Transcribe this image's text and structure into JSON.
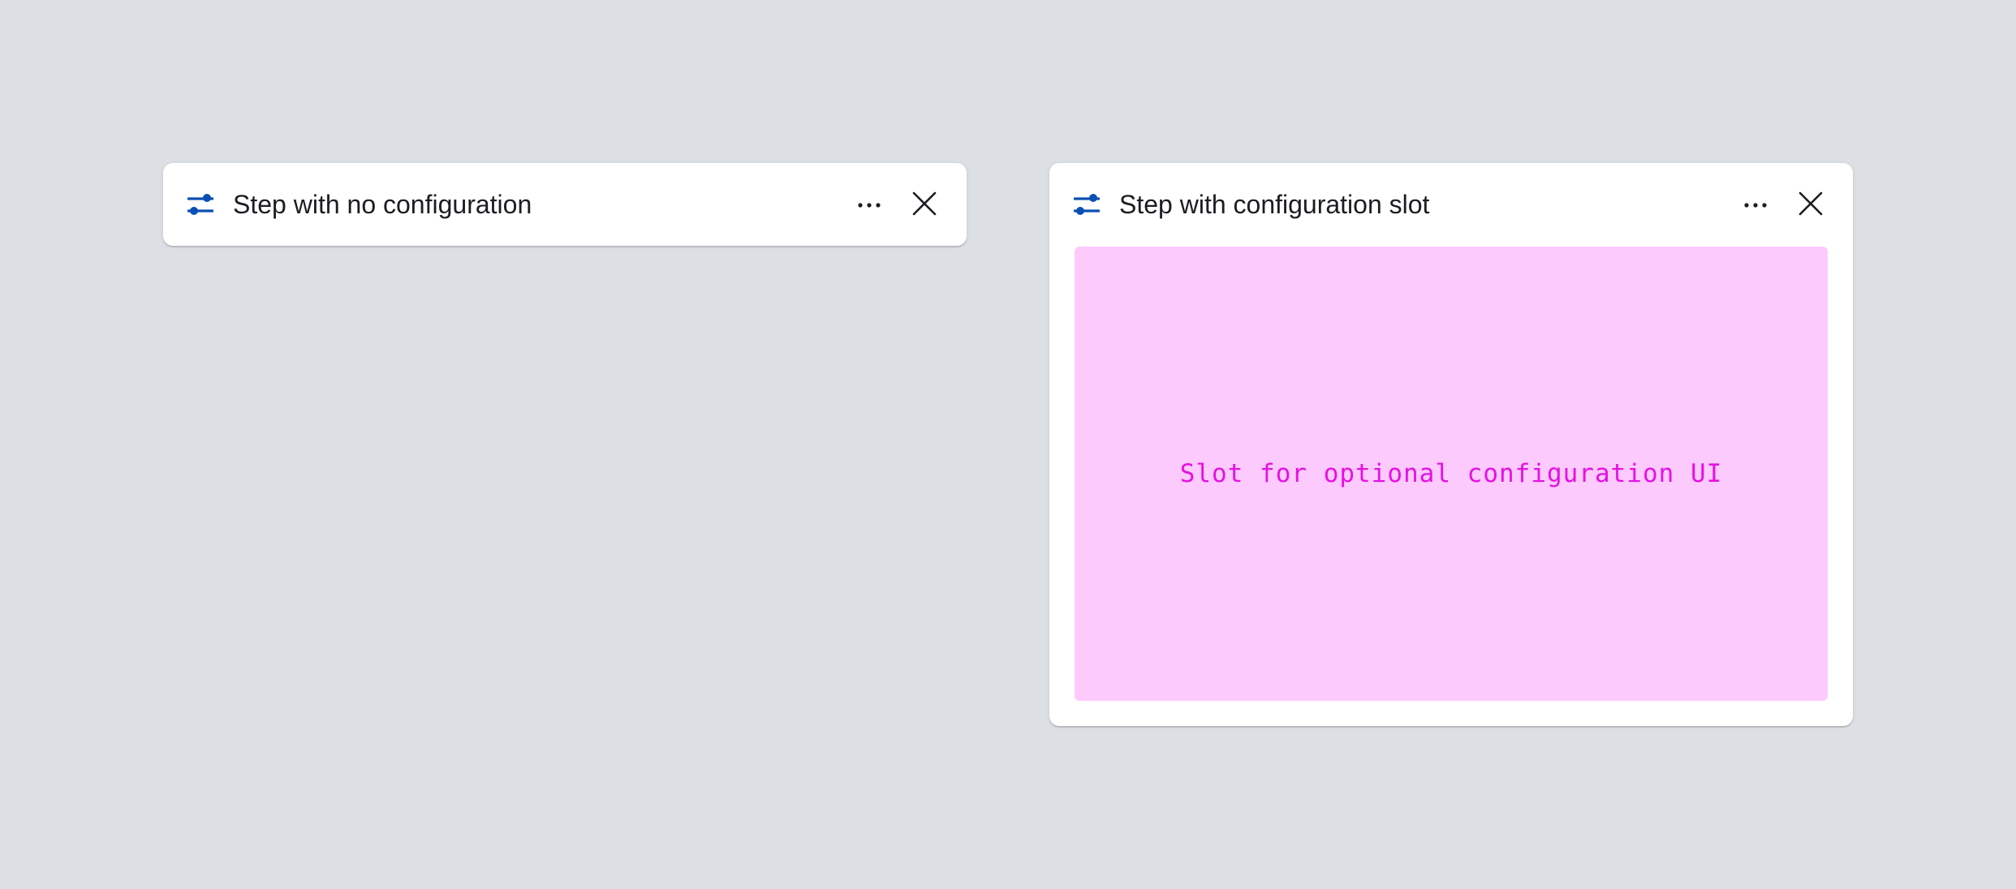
{
  "colors": {
    "background": "#dce0e4",
    "card": "#ffffff",
    "icon_accent": "#0b4fb3",
    "slot_background": "#fdcafd",
    "slot_text": "#e511e2"
  },
  "cards": [
    {
      "title": "Step with no configuration",
      "icon": "sliders-icon",
      "actions": [
        "more-icon",
        "close-icon"
      ]
    },
    {
      "title": "Step with configuration slot",
      "icon": "sliders-icon",
      "actions": [
        "more-icon",
        "close-icon"
      ],
      "slot_label": "Slot for optional configuration UI"
    }
  ]
}
